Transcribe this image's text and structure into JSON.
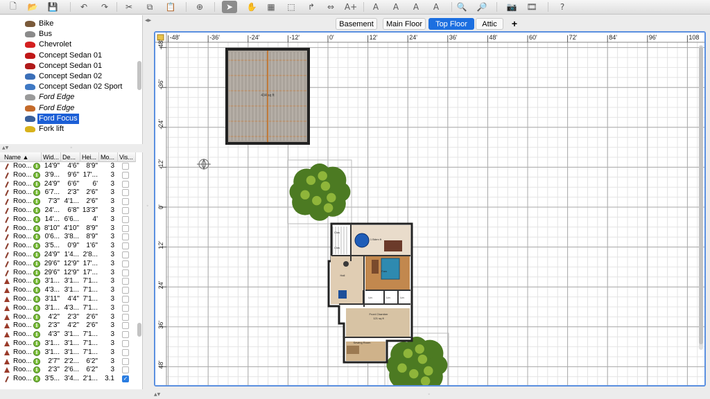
{
  "toolbar": {
    "buttons": [
      {
        "name": "new-home-icon",
        "glyph": "🗋"
      },
      {
        "name": "open-icon",
        "glyph": "📂"
      },
      {
        "name": "save-icon",
        "glyph": "💾"
      },
      {
        "name": "undo-icon",
        "glyph": "↶"
      },
      {
        "name": "redo-icon",
        "glyph": "↷"
      },
      {
        "name": "cut-icon",
        "glyph": "✂"
      },
      {
        "name": "copy-icon",
        "glyph": "⧉"
      },
      {
        "name": "paste-icon",
        "glyph": "📋"
      },
      {
        "name": "add-furniture-icon",
        "glyph": "⊕"
      },
      {
        "name": "select-mode-icon",
        "glyph": "➤"
      },
      {
        "name": "pan-mode-icon",
        "glyph": "✋"
      },
      {
        "name": "create-walls-icon",
        "glyph": "▦"
      },
      {
        "name": "create-rooms-icon",
        "glyph": "⬚"
      },
      {
        "name": "create-polylines-icon",
        "glyph": "↱"
      },
      {
        "name": "create-dimensions-icon",
        "glyph": "⇔"
      },
      {
        "name": "add-text-icon",
        "glyph": "A+"
      },
      {
        "name": "increase-text-size-icon",
        "glyph": "A"
      },
      {
        "name": "decrease-text-size-icon",
        "glyph": "A"
      },
      {
        "name": "bold-text-icon",
        "glyph": "A"
      },
      {
        "name": "italic-text-icon",
        "glyph": "A"
      },
      {
        "name": "zoom-in-icon",
        "glyph": "🔍"
      },
      {
        "name": "zoom-out-icon",
        "glyph": "🔎"
      },
      {
        "name": "create-photo-icon",
        "glyph": "📷"
      },
      {
        "name": "create-video-icon",
        "glyph": "🎞"
      },
      {
        "name": "help-icon",
        "glyph": "?"
      }
    ]
  },
  "catalog": {
    "items": [
      {
        "label": "Bike",
        "color": "#7a5a3a",
        "italic": false,
        "selected": false
      },
      {
        "label": "Bus",
        "color": "#8a8a8a",
        "italic": false,
        "selected": false
      },
      {
        "label": "Chevrolet",
        "color": "#d42020",
        "italic": false,
        "selected": false
      },
      {
        "label": "Concept Sedan 01",
        "color": "#c01818",
        "italic": false,
        "selected": false
      },
      {
        "label": "Concept Sedan 01",
        "color": "#b01a1a",
        "italic": false,
        "selected": false
      },
      {
        "label": "Concept Sedan 02",
        "color": "#3b6fb8",
        "italic": false,
        "selected": false
      },
      {
        "label": "Concept Sedan 02 Sport",
        "color": "#3f79c4",
        "italic": false,
        "selected": false
      },
      {
        "label": "Ford Edge",
        "color": "#9a9a9a",
        "italic": true,
        "selected": false
      },
      {
        "label": "Ford Edge",
        "color": "#c46a2a",
        "italic": true,
        "selected": false
      },
      {
        "label": "Ford Focus",
        "color": "#3a5f9a",
        "italic": false,
        "selected": true
      },
      {
        "label": "Fork lift",
        "color": "#d8b21c",
        "italic": false,
        "selected": false
      }
    ]
  },
  "furniture": {
    "columns": [
      "Name ▲",
      "Wid...",
      "De...",
      "Hei...",
      "Mo...",
      "Vis..."
    ],
    "rows": [
      {
        "type": "room",
        "name": "Roo...",
        "w": "14'9\"",
        "d": "4'6\"",
        "h": "8'9\"",
        "m": "3",
        "v": false
      },
      {
        "type": "room",
        "name": "Roo...",
        "w": "3'9...",
        "d": "9'6\"",
        "h": "17'...",
        "m": "3",
        "v": false
      },
      {
        "type": "room",
        "name": "Roo...",
        "w": "24'9\"",
        "d": "6'6\"",
        "h": "6'",
        "m": "3",
        "v": false
      },
      {
        "type": "room",
        "name": "Roo...",
        "w": "6'7...",
        "d": "2'3\"",
        "h": "2'6\"",
        "m": "3",
        "v": false
      },
      {
        "type": "room",
        "name": "Roo...",
        "w": "7'3\"",
        "d": "4'1...",
        "h": "2'6\"",
        "m": "3",
        "v": false
      },
      {
        "type": "room",
        "name": "Roo...",
        "w": "24'...",
        "d": "6'8\"",
        "h": "13'3\"",
        "m": "3",
        "v": false
      },
      {
        "type": "room",
        "name": "Roo...",
        "w": "14'...",
        "d": "6'6...",
        "h": "4'",
        "m": "3",
        "v": false
      },
      {
        "type": "room",
        "name": "Roo...",
        "w": "8'10\"",
        "d": "4'10\"",
        "h": "8'9\"",
        "m": "3",
        "v": false
      },
      {
        "type": "room",
        "name": "Roo...",
        "w": "0'6...",
        "d": "3'8...",
        "h": "8'9\"",
        "m": "3",
        "v": false
      },
      {
        "type": "room",
        "name": "Roo...",
        "w": "3'5...",
        "d": "0'9\"",
        "h": "1'6\"",
        "m": "3",
        "v": false
      },
      {
        "type": "room",
        "name": "Roo...",
        "w": "24'9\"",
        "d": "1'4...",
        "h": "2'8...",
        "m": "3",
        "v": false
      },
      {
        "type": "room",
        "name": "Roo...",
        "w": "29'6\"",
        "d": "12'9\"",
        "h": "17'...",
        "m": "3",
        "v": false
      },
      {
        "type": "room",
        "name": "Roo...",
        "w": "29'6\"",
        "d": "12'9\"",
        "h": "17'...",
        "m": "3",
        "v": false
      },
      {
        "type": "roof",
        "name": "Roo...",
        "w": "3'1...",
        "d": "3'1...",
        "h": "7'1...",
        "m": "3",
        "v": false
      },
      {
        "type": "roof",
        "name": "Roo...",
        "w": "4'3...",
        "d": "3'1...",
        "h": "7'1...",
        "m": "3",
        "v": false
      },
      {
        "type": "roof",
        "name": "Roo...",
        "w": "3'11\"",
        "d": "4'4\"",
        "h": "7'1...",
        "m": "3",
        "v": false
      },
      {
        "type": "roof",
        "name": "Roo...",
        "w": "3'1...",
        "d": "4'3...",
        "h": "7'1...",
        "m": "3",
        "v": false
      },
      {
        "type": "roof",
        "name": "Roo...",
        "w": "4'2\"",
        "d": "2'3\"",
        "h": "2'6\"",
        "m": "3",
        "v": false
      },
      {
        "type": "roof",
        "name": "Roo...",
        "w": "2'3\"",
        "d": "4'2\"",
        "h": "2'6\"",
        "m": "3",
        "v": false
      },
      {
        "type": "roof",
        "name": "Roo...",
        "w": "4'3\"",
        "d": "3'1...",
        "h": "7'1...",
        "m": "3",
        "v": false
      },
      {
        "type": "roof",
        "name": "Roo...",
        "w": "3'1...",
        "d": "3'1...",
        "h": "7'1...",
        "m": "3",
        "v": false
      },
      {
        "type": "roof",
        "name": "Roo...",
        "w": "3'1...",
        "d": "3'1...",
        "h": "7'1...",
        "m": "3",
        "v": false
      },
      {
        "type": "roof",
        "name": "Roo...",
        "w": "2'7\"",
        "d": "2'2...",
        "h": "6'2\"",
        "m": "3",
        "v": false
      },
      {
        "type": "roof",
        "name": "Roo...",
        "w": "2'3\"",
        "d": "2'6...",
        "h": "6'2\"",
        "m": "3",
        "v": false
      },
      {
        "type": "room",
        "name": "Roo...",
        "w": "3'5...",
        "d": "3'4...",
        "h": "2'1...",
        "m": "3.1",
        "v": true
      }
    ]
  },
  "levels": {
    "tabs": [
      "Basement",
      "Main Floor",
      "Top Floor",
      "Attic"
    ],
    "active": "Top Floor",
    "add_label": "+"
  },
  "plan": {
    "ruler_x": [
      "-48'",
      "-36'",
      "-24'",
      "-12'",
      "0'",
      "12'",
      "24'",
      "36'",
      "48'",
      "60'",
      "72'",
      "84'",
      "96'",
      "108"
    ],
    "ruler_y": [
      "-48'",
      "-36'",
      "-24'",
      "-12'",
      "0'",
      "12'",
      "24'",
      "36'",
      "48'"
    ],
    "room_labels": {
      "garage_area": "434 sq ft",
      "bedroom": "1 Bdrm ft",
      "closet_a": "Clos",
      "closet_b": "Clos",
      "hall": "Hall",
      "family": "Fam",
      "link_a": "Lin",
      "link_b": "Lin",
      "link_c": "Lin",
      "front_chamber": "Front Chamber",
      "front_chamber_area": "121 sq ft",
      "sewing_room": "Sewing Room"
    }
  },
  "colors": {
    "selection": "#1c5fd6",
    "active_tab": "#1c6fe0",
    "plan_border": "#5a8fe0",
    "grid_minor": "#e4e4e4",
    "grid_major": "#aaaaaa"
  }
}
